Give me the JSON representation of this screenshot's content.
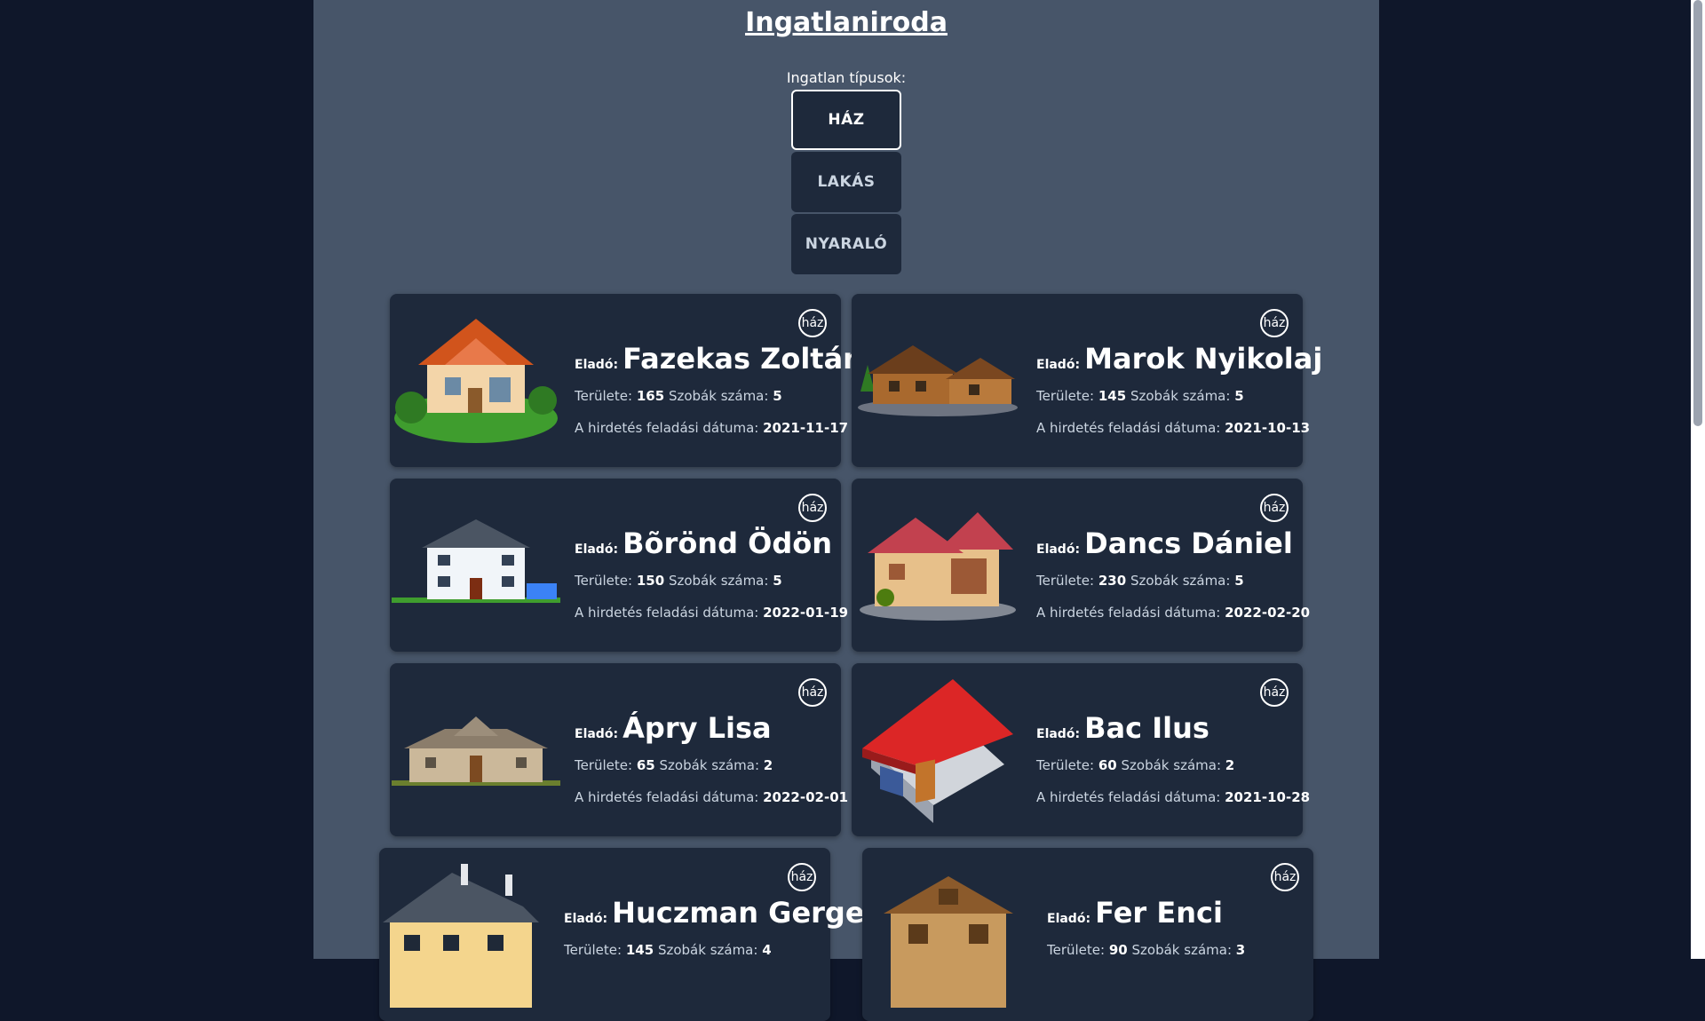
{
  "title": "Ingatlaniroda",
  "filter": {
    "label": "Ingatlan típusok:",
    "options": [
      "HÁZ",
      "LAKÁS",
      "NYARALÓ"
    ],
    "selected": "HÁZ"
  },
  "labels": {
    "seller": "Eladó:",
    "area": "Területe:",
    "rooms": "Szobák száma:",
    "date": "A hirdetés feladási dátuma:"
  },
  "listings": [
    {
      "type": "ház",
      "seller": "Fazekas Zoltán",
      "area": "165",
      "rooms": "5",
      "date": "2021-11-17",
      "image": "house-orange-roof-icon"
    },
    {
      "type": "ház",
      "seller": "Marok Nyikolaj",
      "area": "145",
      "rooms": "5",
      "date": "2021-10-13",
      "image": "log-cabin-icon"
    },
    {
      "type": "ház",
      "seller": "Bõrönd Ödön",
      "area": "150",
      "rooms": "5",
      "date": "2022-01-19",
      "image": "white-house-solar-icon"
    },
    {
      "type": "ház",
      "seller": "Dancs Dániel",
      "area": "230",
      "rooms": "5",
      "date": "2022-02-20",
      "image": "wooden-house-red-roof-icon"
    },
    {
      "type": "ház",
      "seller": "Ápry Lisa",
      "area": "65",
      "rooms": "2",
      "date": "2022-02-01",
      "image": "stone-villa-icon"
    },
    {
      "type": "ház",
      "seller": "Bac Ilus",
      "area": "60",
      "rooms": "2",
      "date": "2021-10-28",
      "image": "red-roof-house-icon"
    },
    {
      "type": "ház",
      "seller": "Huczman Gergely",
      "area": "145",
      "rooms": "4",
      "date": "",
      "image": "yellow-house-grey-roof-icon"
    },
    {
      "type": "ház",
      "seller": "Fer Enci",
      "area": "90",
      "rooms": "3",
      "date": "",
      "image": "timber-house-icon"
    }
  ]
}
